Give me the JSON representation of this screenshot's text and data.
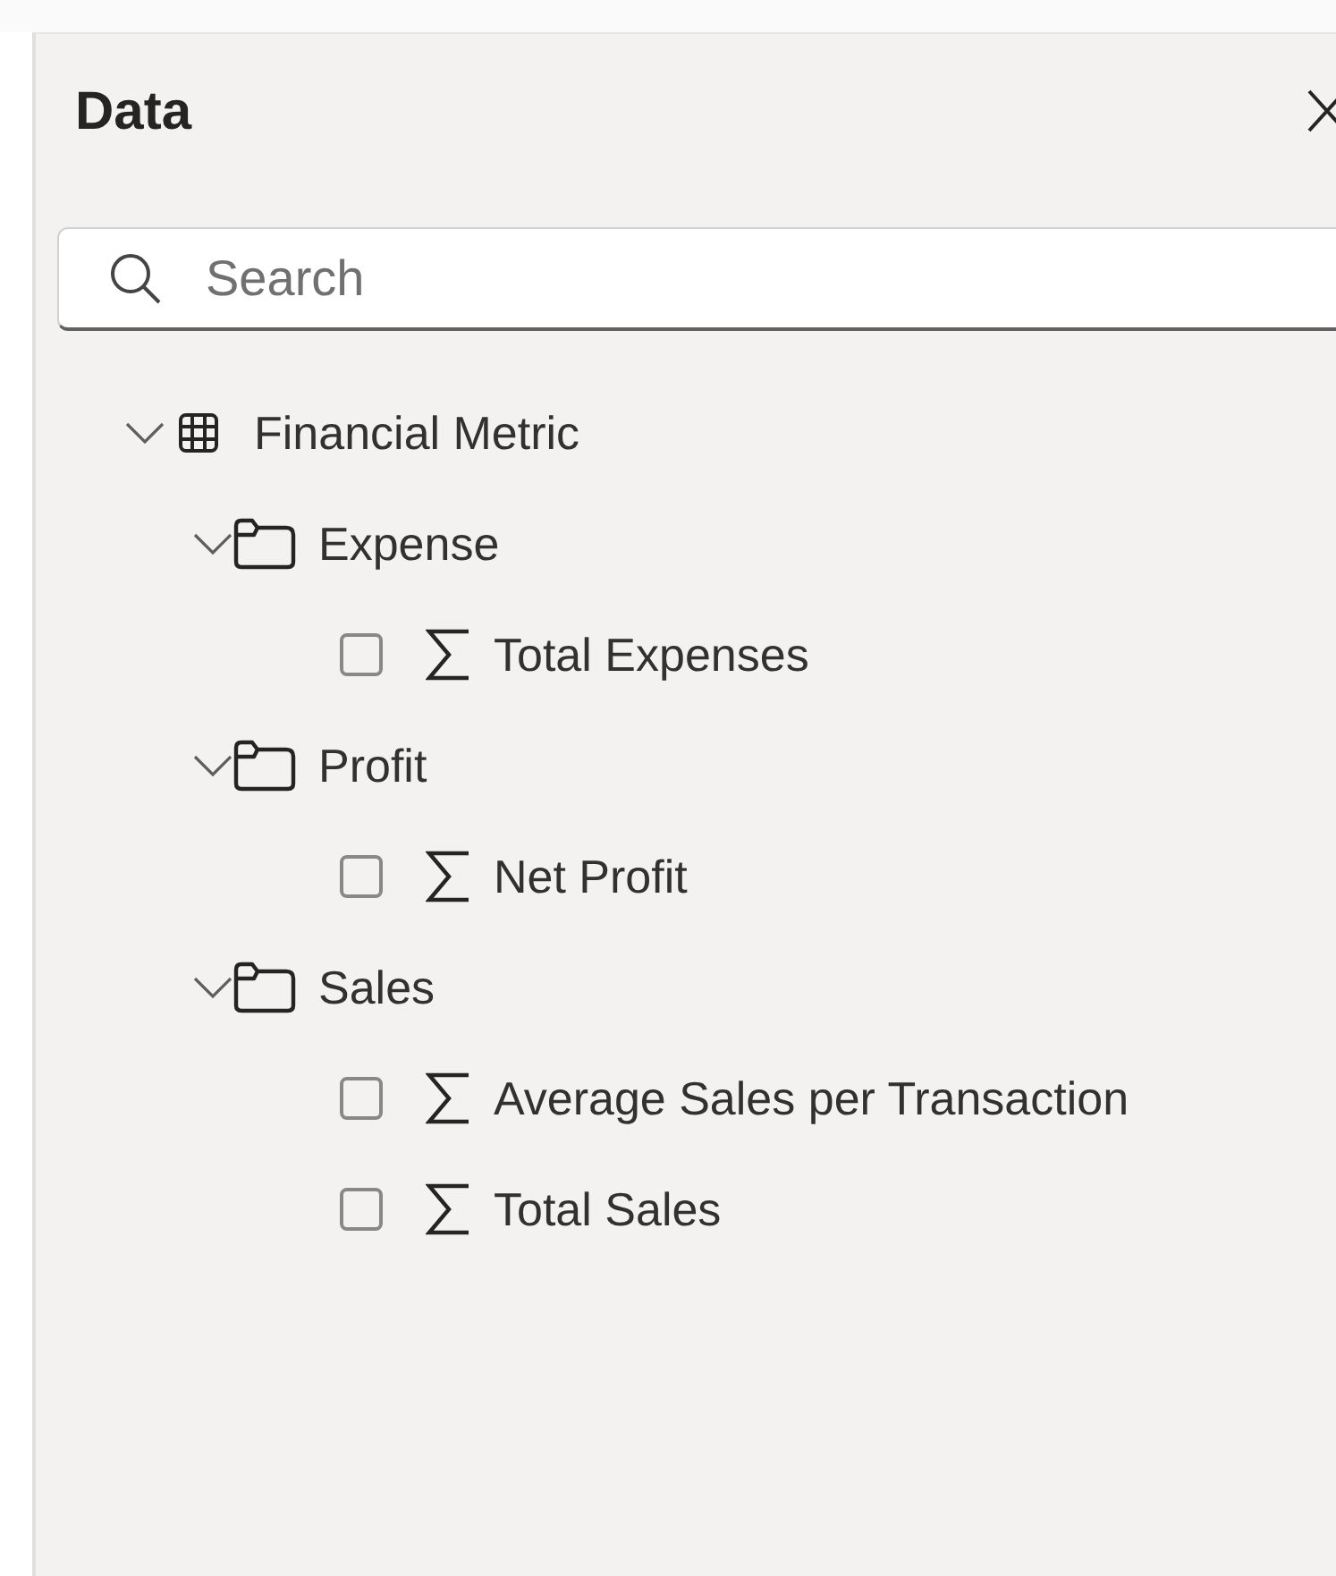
{
  "panel": {
    "title": "Data"
  },
  "search": {
    "placeholder": "Search"
  },
  "tree": [
    {
      "kind": "table",
      "label": "Financial Metric",
      "expanded": true,
      "children": [
        {
          "kind": "folder",
          "label": "Expense",
          "expanded": true,
          "children": [
            {
              "kind": "measure",
              "label": "Total Expenses",
              "checked": false
            }
          ]
        },
        {
          "kind": "folder",
          "label": "Profit",
          "expanded": true,
          "children": [
            {
              "kind": "measure",
              "label": "Net Profit",
              "checked": false
            }
          ]
        },
        {
          "kind": "folder",
          "label": "Sales",
          "expanded": true,
          "children": [
            {
              "kind": "measure",
              "label": "Average Sales per Transaction",
              "checked": false
            },
            {
              "kind": "measure",
              "label": "Total Sales",
              "checked": false
            }
          ]
        }
      ]
    }
  ]
}
